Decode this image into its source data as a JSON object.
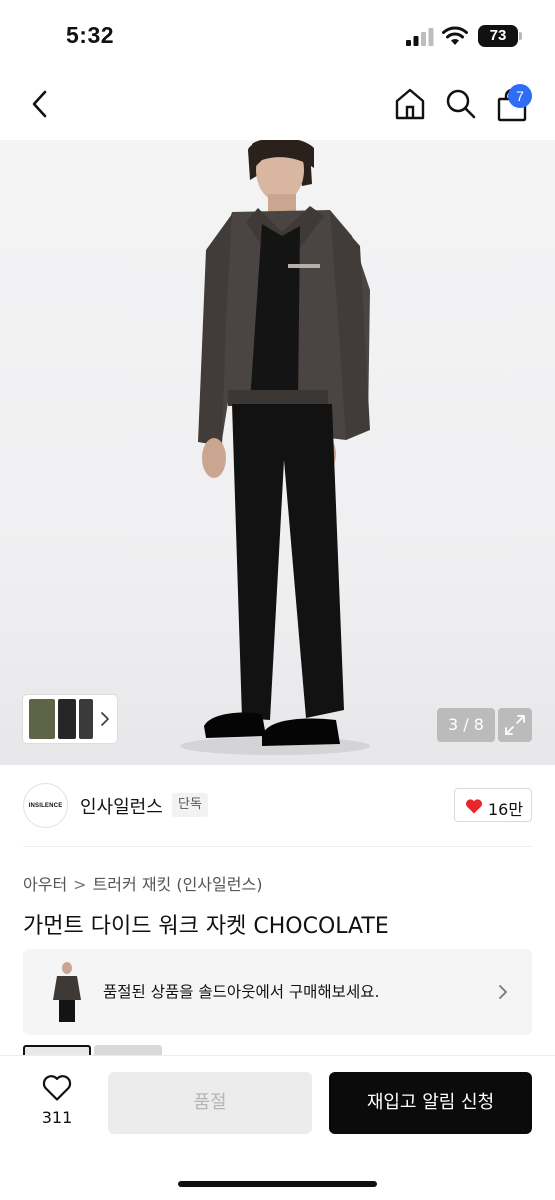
{
  "status_bar": {
    "time": "5:32",
    "battery": "73"
  },
  "nav": {
    "cart_badge": "7"
  },
  "gallery": {
    "counter": "3 / 8"
  },
  "brand": {
    "name": "인사일런스",
    "logo_text": "INSILENCE",
    "tag": "단독",
    "likes": "16만",
    "like_color": "#e8262b"
  },
  "breadcrumb": {
    "parent": "아우터",
    "separator": ">",
    "child": "트러커 재킷 (인사일런스)"
  },
  "product": {
    "title": "가먼트 다이드 워크 자켓 CHOCOLATE"
  },
  "soldout_banner": {
    "message": "품절된 상품을 솔드아웃에서 구매해보세요."
  },
  "bottom_bar": {
    "wish_count": "311",
    "soldout_label": "품절",
    "restock_label": "재입고 알림 신청"
  },
  "colors": {
    "accent_blue": "#2f6df6",
    "primary_black": "#0b0b0b",
    "disabled_gray": "#ececec"
  }
}
